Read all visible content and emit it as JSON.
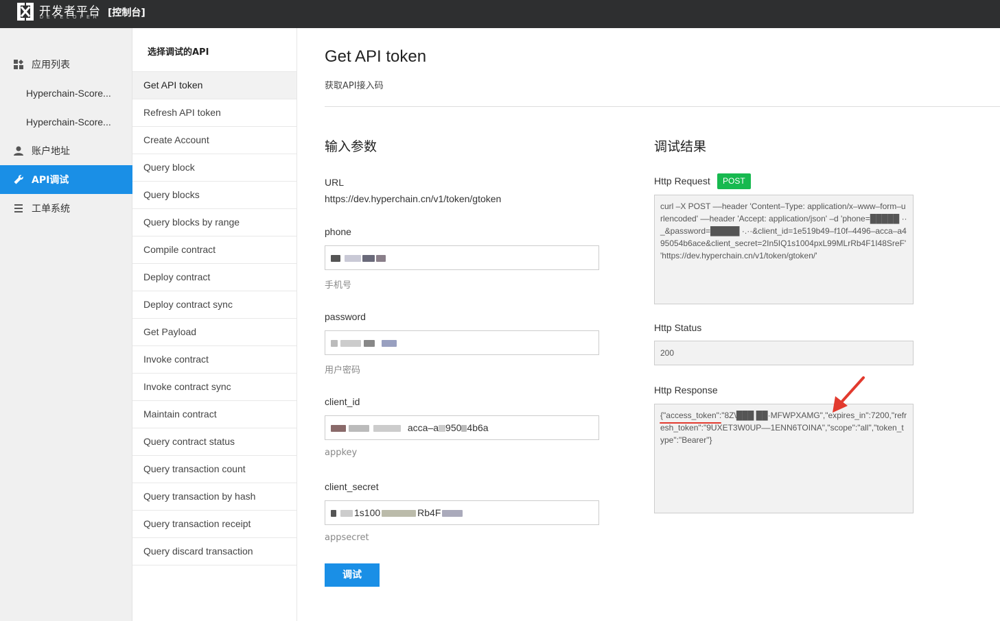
{
  "header": {
    "brand": "开发者平台",
    "brand_sub": "DEVELOPER",
    "console": "[控制台]"
  },
  "leftnav": {
    "items": [
      {
        "label": "应用列表",
        "icon": "grid-icon"
      },
      {
        "label": "Hyperchain-Score..."
      },
      {
        "label": "Hyperchain-Score..."
      },
      {
        "label": "账户地址",
        "icon": "user-icon"
      },
      {
        "label": "API调试",
        "icon": "wrench-icon",
        "active": true
      },
      {
        "label": "工单系统",
        "icon": "list-icon"
      }
    ]
  },
  "apilist": {
    "title": "选择调试的API",
    "items": [
      "Get API token",
      "Refresh API token",
      "Create Account",
      "Query block",
      "Query blocks",
      "Query blocks by range",
      "Compile contract",
      "Deploy contract",
      "Deploy contract sync",
      "Get Payload",
      "Invoke contract",
      "Invoke contract sync",
      "Maintain contract",
      "Query contract status",
      "Query transaction count",
      "Query transaction by hash",
      "Query transaction receipt",
      "Query discard transaction"
    ],
    "selected_index": 0
  },
  "main": {
    "title": "Get API token",
    "subtitle": "获取API接入码",
    "input_section": "输入参数",
    "result_section": "调试结果",
    "url_label": "URL",
    "url_value": "https://dev.hyperchain.cn/v1/token/gtoken",
    "phone_label": "phone",
    "phone_hint": "手机号",
    "password_label": "password",
    "password_hint": "用户密码",
    "client_id_label": "client_id",
    "client_id_value": "acca–a",
    "client_id_value2": "950",
    "client_id_value3": "4b6a",
    "client_id_hint": "appkey",
    "client_secret_label": "client_secret",
    "client_secret_value": "1s100",
    "client_secret_value2": "Rb4F",
    "client_secret_hint": "appsecret",
    "debug_button": "调试",
    "http_request_label": "Http Request",
    "http_method": "POST",
    "http_request_body": "curl –X POST ––header 'Content–Type: application/x–www–form–urlencoded' ––header 'Accept: application/json' –d 'phone=█████ ··_&password=█████ ·.··&client_id=1e519b49–f10f–4496–acca–a495054b6ace&client_secret=2In5IQ1s1004pxL99MLrRb4F1I48SreF' 'https://dev.hyperchain.cn/v1/token/gtoken/'",
    "http_status_label": "Http Status",
    "http_status_value": "200",
    "http_response_label": "Http Response",
    "http_response_body": "{\"access_token\":\"8Z\\███ ██·MFWPXAMG\",\"expires_in\":7200,\"refresh_token\":\"9UXET3W0UP––1ENN6TOINA\",\"scope\":\"all\",\"token_type\":\"Bearer\"}"
  },
  "colors": {
    "topbar": "#2e2f30",
    "accent": "#1a8fe6",
    "post_badge": "#17b94f",
    "annotation": "#e23a2e"
  }
}
